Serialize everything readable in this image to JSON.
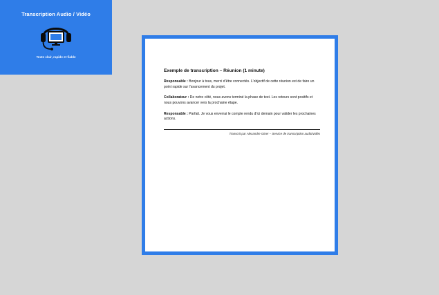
{
  "brand": {
    "title": "Transcription Audio / Vidéo",
    "tagline": "Texte clair, rapide et fiable",
    "icon": "headset-monitor-icon",
    "color": "#2f7de8"
  },
  "document": {
    "heading": "Exemple de transcription – Réunion (1 minute)",
    "paragraphs": [
      {
        "speaker": "Responsable :",
        "text": " Bonjour à tous, merci d’être connectés. L’objectif de cette réunion est de faire un point rapide sur l’avancement du projet."
      },
      {
        "speaker": "Collaborateur :",
        "text": " De notre côté, nous avons terminé la phase de test. Les retours sont positifs et nous pouvons avancer vers la prochaine étape."
      },
      {
        "speaker": "Responsable :",
        "text": " Parfait. Je vous enverrai le compte rendu d’ici demain pour valider les prochaines actions."
      }
    ],
    "credit": "Transcrit par Alexandre Giner – Service de transcription audio/vidéo",
    "frame_color": "#2f7de8"
  }
}
